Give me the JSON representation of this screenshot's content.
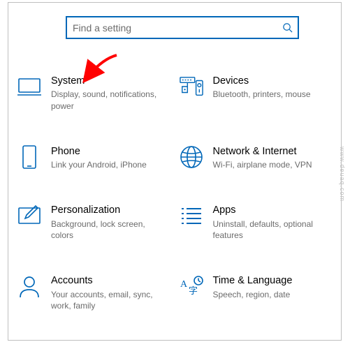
{
  "search": {
    "placeholder": "Find a setting",
    "value": ""
  },
  "accent": "#0067b8",
  "tiles": [
    {
      "title": "System",
      "desc": "Display, sound, notifications, power"
    },
    {
      "title": "Devices",
      "desc": "Bluetooth, printers, mouse"
    },
    {
      "title": "Phone",
      "desc": "Link your Android, iPhone"
    },
    {
      "title": "Network & Internet",
      "desc": "Wi-Fi, airplane mode, VPN"
    },
    {
      "title": "Personalization",
      "desc": "Background, lock screen, colors"
    },
    {
      "title": "Apps",
      "desc": "Uninstall, defaults, optional features"
    },
    {
      "title": "Accounts",
      "desc": "Your accounts, email, sync, work, family"
    },
    {
      "title": "Time & Language",
      "desc": "Speech, region, date"
    }
  ],
  "watermark": "www.deuaq.com",
  "annotation": {
    "type": "arrow",
    "target": "System",
    "color": "#ff0000"
  }
}
